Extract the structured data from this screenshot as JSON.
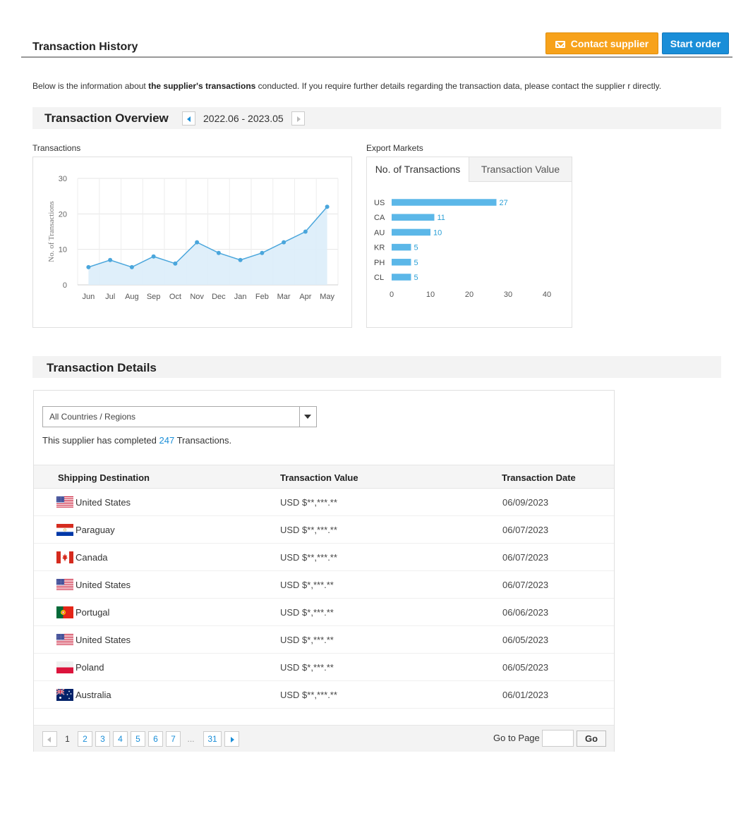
{
  "header": {
    "title": "Transaction History",
    "contact_label": "Contact supplier",
    "start_label": "Start order"
  },
  "intro": {
    "before": "Below is the information about ",
    "bold": "the supplier's transactions",
    "after": " conducted. If you require further details regarding the transaction data, please contact the supplier  r directly."
  },
  "overview": {
    "title": "Transaction Overview",
    "date_range": "2022.06 - 2023.05"
  },
  "transactions_panel": {
    "label": "Transactions"
  },
  "markets_panel": {
    "label": "Export Markets",
    "tabs": [
      "No. of Transactions",
      "Transaction Value"
    ]
  },
  "chart_data": [
    {
      "type": "area",
      "ylabel": "No. of Transactions",
      "categories": [
        "Jun",
        "Jul",
        "Aug",
        "Sep",
        "Oct",
        "Nov",
        "Dec",
        "Jan",
        "Feb",
        "Mar",
        "Apr",
        "May"
      ],
      "values": [
        5,
        7,
        5,
        8,
        6,
        12,
        9,
        7,
        9,
        12,
        15,
        22
      ],
      "ylim": [
        0,
        30
      ],
      "yticks": [
        0,
        10,
        20,
        30
      ],
      "grid": true,
      "color": "#4aa6dc",
      "fill": "#dcedf9"
    },
    {
      "type": "bar",
      "orientation": "horizontal",
      "categories": [
        "US",
        "CA",
        "AU",
        "KR",
        "PH",
        "CL"
      ],
      "values": [
        27,
        11,
        10,
        5,
        5,
        5
      ],
      "xlim": [
        0,
        40
      ],
      "xticks": [
        0,
        10,
        20,
        30,
        40
      ],
      "color": "#5bb7e8",
      "label_color": "#2a9fd6"
    }
  ],
  "details": {
    "title": "Transaction Details",
    "filter_value": "All Countries / Regions",
    "completed_before": "This supplier has completed ",
    "completed_count": "247",
    "completed_after": " Transactions.",
    "columns": [
      "Shipping Destination",
      "Transaction Value",
      "Transaction Date"
    ],
    "rows": [
      {
        "flag": "us-flag",
        "country": "United States",
        "value": "USD $**,***.**",
        "date": "06/09/2023"
      },
      {
        "flag": "py-flag",
        "country": "Paraguay",
        "value": "USD $**,***.**",
        "date": "06/07/2023"
      },
      {
        "flag": "ca-flag",
        "country": "Canada",
        "value": "USD $**,***.**",
        "date": "06/07/2023"
      },
      {
        "flag": "us-flag",
        "country": "United States",
        "value": "USD $*,***.**",
        "date": "06/07/2023"
      },
      {
        "flag": "pt-flag",
        "country": "Portugal",
        "value": "USD $*,***.**",
        "date": "06/06/2023"
      },
      {
        "flag": "us-flag",
        "country": "United States",
        "value": "USD $*,***.**",
        "date": "06/05/2023"
      },
      {
        "flag": "pl-flag",
        "country": "Poland",
        "value": "USD $*,***.**",
        "date": "06/05/2023"
      },
      {
        "flag": "au-flag",
        "country": "Australia",
        "value": "USD $**,***.**",
        "date": "06/01/2023"
      }
    ]
  },
  "pagination": {
    "current": "1",
    "pages": [
      "2",
      "3",
      "4",
      "5",
      "6",
      "7"
    ],
    "ellipsis": "...",
    "last": "31",
    "goto_label": "Go to Page",
    "go_label": "Go"
  },
  "colors": {
    "accent": "#1a8ed8",
    "contact": "#f7a21b"
  }
}
